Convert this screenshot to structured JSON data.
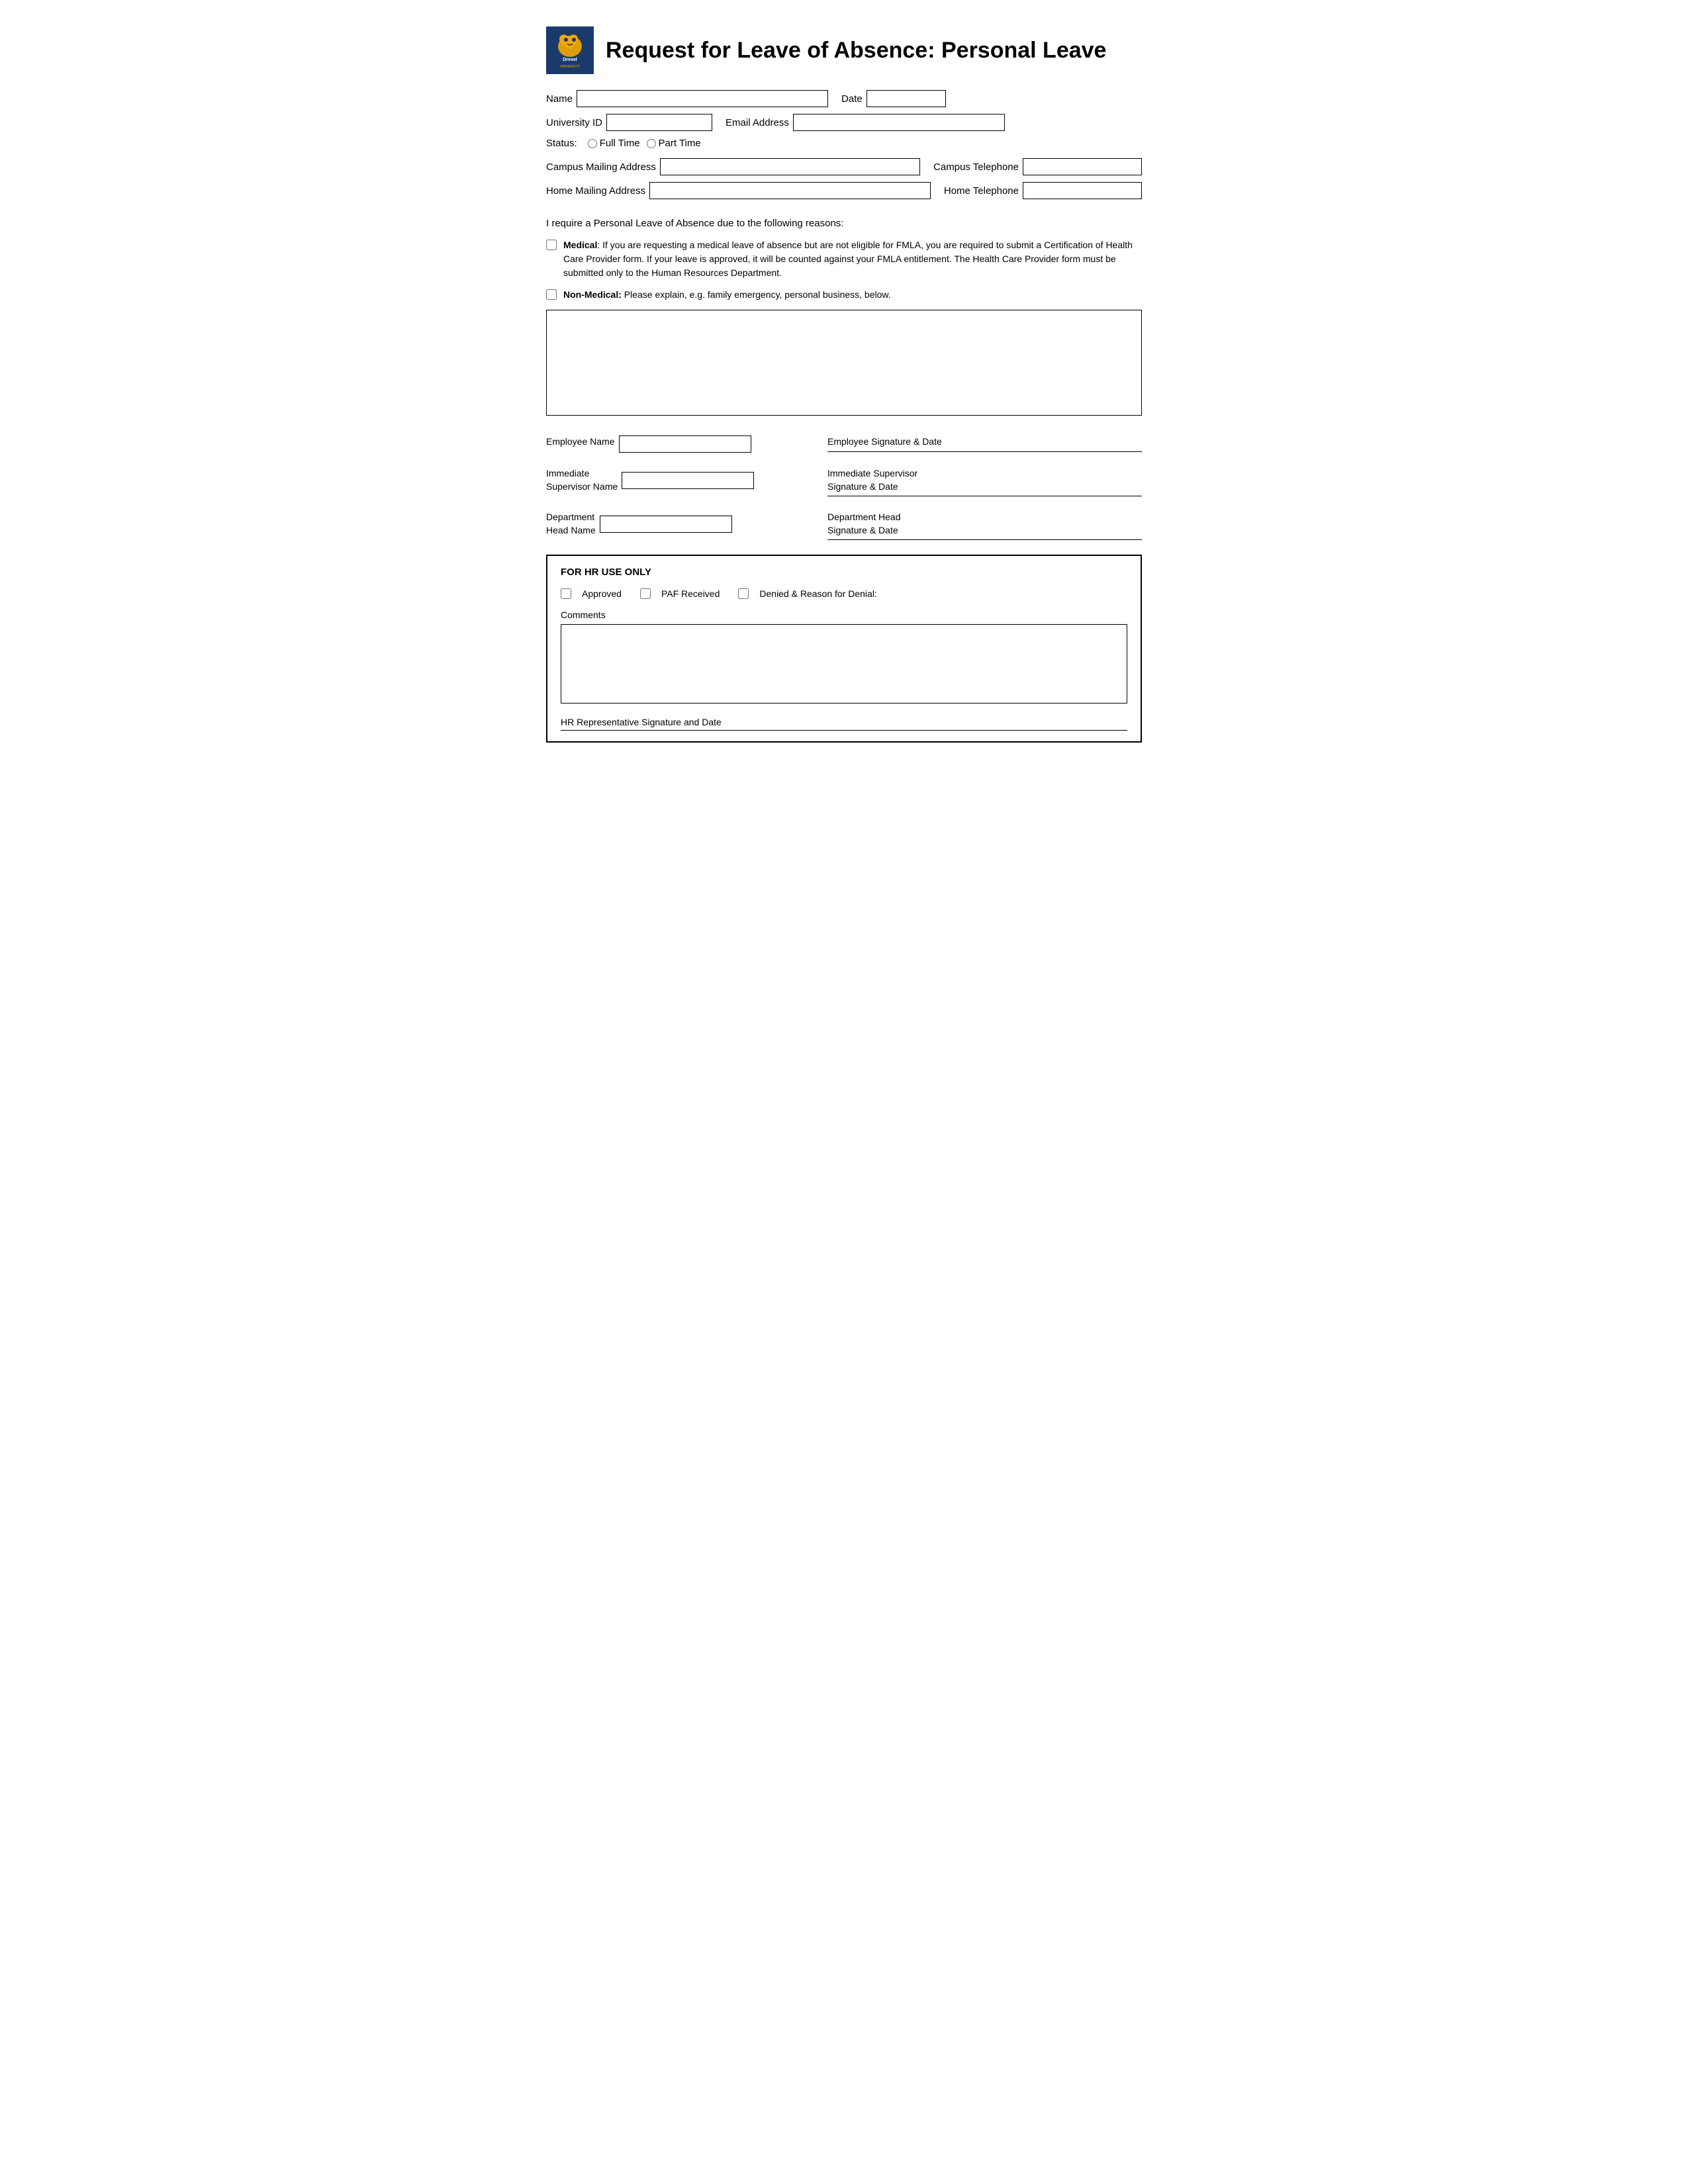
{
  "header": {
    "title": "Request for Leave of Absence: Personal Leave"
  },
  "form": {
    "name_label": "Name",
    "date_label": "Date",
    "uid_label": "University ID",
    "email_label": "Email Address",
    "status_label": "Status:",
    "status_fulltime": "Full Time",
    "status_parttime": "Part Time",
    "campus_addr_label": "Campus Mailing Address",
    "campus_tel_label": "Campus Telephone",
    "home_addr_label": "Home Mailing Address",
    "home_tel_label": "Home Telephone"
  },
  "reasons": {
    "intro": "I require a Personal Leave of Absence due to the following reasons:",
    "medical_bold": "Medical",
    "medical_text": ": If you are requesting a medical leave of absence but are not eligible for FMLA, you are required to submit a Certification of Health Care Provider form. If your leave is approved, it will be counted against your FMLA entitlement. The Health Care Provider form must be submitted only to the Human Resources Department.",
    "nonmedical_bold": "Non-Medical:",
    "nonmedical_text": " Please explain, e.g. family emergency, personal business, below."
  },
  "signatures": {
    "employee_name_label": "Employee Name",
    "employee_sig_label": "Employee Signature & Date",
    "supervisor_name_label": "Immediate\nSupervisor Name",
    "supervisor_sig_label": "Immediate Supervisor\nSignature & Date",
    "dept_head_name_label": "Department\nHead Name",
    "dept_head_sig_label": "Department Head\nSignature & Date"
  },
  "hr_section": {
    "title": "FOR HR USE ONLY",
    "approved_label": "Approved",
    "paf_label": "PAF Received",
    "denied_label": "Denied & Reason for Denial:",
    "comments_label": "Comments",
    "hr_sig_label": "HR Representative Signature and Date"
  }
}
